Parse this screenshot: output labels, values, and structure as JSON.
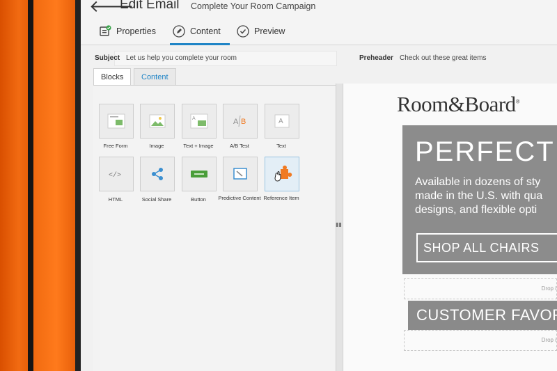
{
  "header": {
    "back_icon": "arrow-left-icon",
    "title": "Edit Email",
    "subtitle": "Complete Your Room Campaign"
  },
  "tabs": [
    {
      "label": "Properties",
      "icon": "properties-icon"
    },
    {
      "label": "Content",
      "icon": "pencil-icon"
    },
    {
      "label": "Preview",
      "icon": "check-icon"
    }
  ],
  "subject": {
    "label": "Subject",
    "value": "Let us help you complete your room"
  },
  "preheader": {
    "label": "Preheader",
    "value": "Check out these great items"
  },
  "panel_tabs": {
    "blocks": "Blocks",
    "content": "Content"
  },
  "blocks": [
    {
      "label": "Free Form",
      "icon": "free-form-icon"
    },
    {
      "label": "Image",
      "icon": "image-icon"
    },
    {
      "label": "Text + Image",
      "icon": "text-image-icon"
    },
    {
      "label": "A/B Test",
      "icon": "ab-test-icon"
    },
    {
      "label": "Text",
      "icon": "text-icon"
    },
    {
      "label": "HTML",
      "icon": "code-icon"
    },
    {
      "label": "Social Share",
      "icon": "share-icon"
    },
    {
      "label": "Button",
      "icon": "button-icon"
    },
    {
      "label": "Predictive Content",
      "icon": "predictive-icon"
    },
    {
      "label": "Reference Item",
      "icon": "puzzle-icon"
    }
  ],
  "preview": {
    "brand": "Room&Board",
    "headline": "PERFECT C",
    "body_lines": [
      "Available in dozens of sty",
      "made in the U.S. with qua",
      "designs, and flexible opti"
    ],
    "cta": "SHOP ALL CHAIRS",
    "drop_text": "Drop i",
    "section_title": "CUSTOMER FAVOR"
  },
  "colors": {
    "accent": "#1f84c6",
    "hero_gray": "#8c8c8c",
    "puzzle_orange": "#f07a22"
  }
}
